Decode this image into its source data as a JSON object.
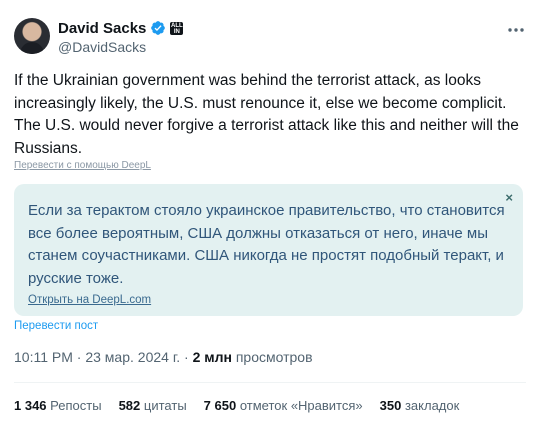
{
  "author": {
    "display_name": "David Sacks",
    "handle": "@DavidSacks",
    "affiliation_badge_text": "ALL IN"
  },
  "tweet": {
    "text": "If the Ukrainian government was behind the terrorist attack, as looks increasingly likely, the U.S. must renounce it, else we become complicit. The U.S. would never forgive a terrorist attack like this and neither will the Russians.",
    "deepl_label": "Перевести с помощью DeepL"
  },
  "translation": {
    "text": "Если за терактом стояло украинское правительство, что становится все более вероятным, США должны отказаться от него, иначе мы станем соучастниками. США никогда не простят подобный теракт, и русские тоже.",
    "open_link": "Открыть на DeepL.com",
    "close_symbol": "×"
  },
  "translate_post_label": "Перевести пост",
  "meta": {
    "time": "10:11 PM",
    "date": "23 мар. 2024 г.",
    "separator": "·",
    "views_count": "2 млн",
    "views_label": "просмотров"
  },
  "stats": [
    {
      "count": "1 346",
      "label": "Репосты"
    },
    {
      "count": "582",
      "label": "цитаты"
    },
    {
      "count": "7 650",
      "label": "отметок «Нравится»"
    },
    {
      "count": "350",
      "label": "закладок"
    }
  ],
  "colors": {
    "verified": "#1d9bf0",
    "translation_bg": "#e3f1f1",
    "link": "#1d9bf0"
  }
}
